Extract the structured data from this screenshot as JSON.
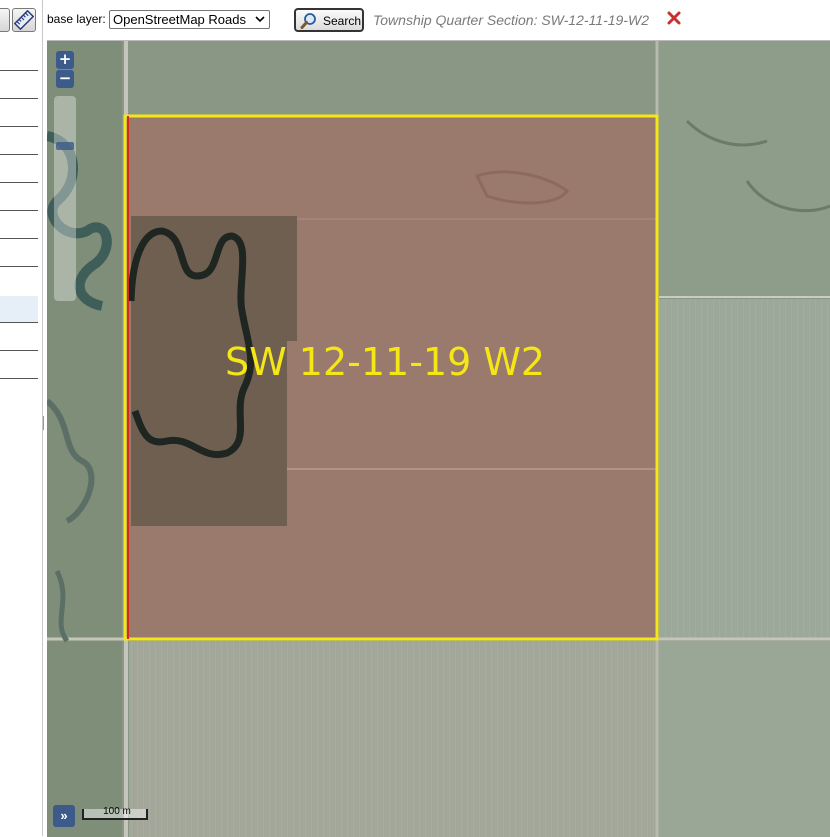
{
  "toolbar": {
    "base_layer_label": "base layer:",
    "base_layer_value": "OpenStreetMap Roads",
    "search_label": "Search",
    "result_text": "Township Quarter Section: SW-12-11-19-W2"
  },
  "map": {
    "parcel_label": "SW 12-11-19 W2",
    "scale_label": "100 m",
    "zoom_in_label": "+",
    "zoom_out_label": "−",
    "expand_label": "»"
  },
  "icons": {
    "search": "magnifier-icon",
    "clear": "close-icon",
    "measure": "ruler-icon"
  },
  "colors": {
    "parcel_outline": "#f5e616",
    "parcel_fill": "#a7625a",
    "parcel_label": "#f5e616",
    "clear_icon": "#c9302c",
    "map_control": "#3c5b8a"
  }
}
